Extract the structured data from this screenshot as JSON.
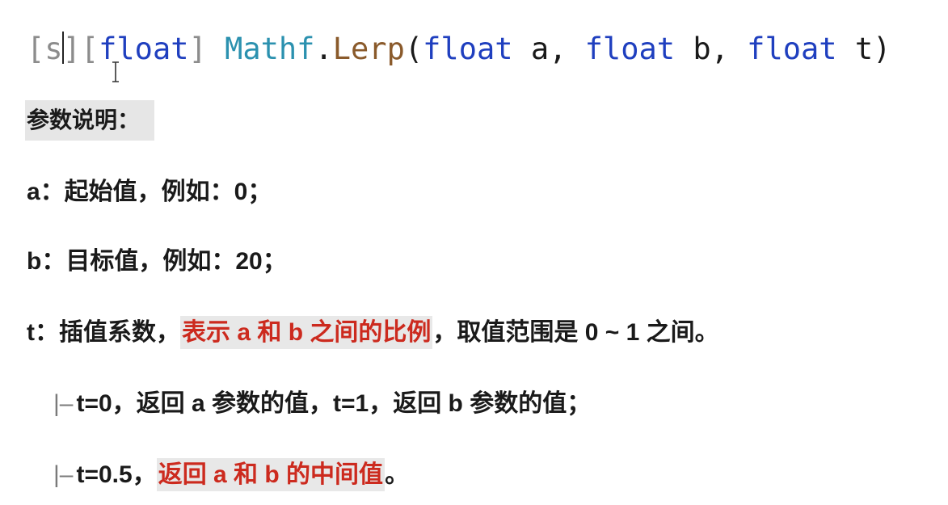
{
  "signature": {
    "attr_static": "s",
    "attr_return": "float",
    "class_name": "Mathf",
    "dot": ".",
    "method": "Lerp",
    "open_paren": "(",
    "param_a_type": "float",
    "param_a_name": "a",
    "param_b_type": "float",
    "param_b_name": "b",
    "param_t_type": "float",
    "param_t_name": "t",
    "comma": ",",
    "close_paren": ")",
    "bracket_open": "[",
    "bracket_close": "]"
  },
  "heading": "参数说明：",
  "params": {
    "a": "a：起始值，例如：0；",
    "b": "b：目标值，例如：20；",
    "t_prefix": "t：插值系数，",
    "t_highlight": "表示 a 和 b 之间的比例",
    "t_suffix": "，取值范围是 0 ~ 1 之间。"
  },
  "notes": {
    "tree_glyph": "|–",
    "note1": "t=0，返回 a 参数的值，t=1，返回 b 参数的值；",
    "note2_prefix": "t=0.5，",
    "note2_highlight": "返回 a 和 b 的中间值",
    "note2_suffix": "。"
  },
  "colors": {
    "keyword": "#1f3fbf",
    "class": "#2b91af",
    "method": "#8a5a2b",
    "highlight_text": "#cc2a1e",
    "highlight_bg": "#e8e8e8"
  },
  "icons": {
    "cursor": "text-cursor-icon",
    "ibeam": "ibeam-pointer-icon"
  }
}
